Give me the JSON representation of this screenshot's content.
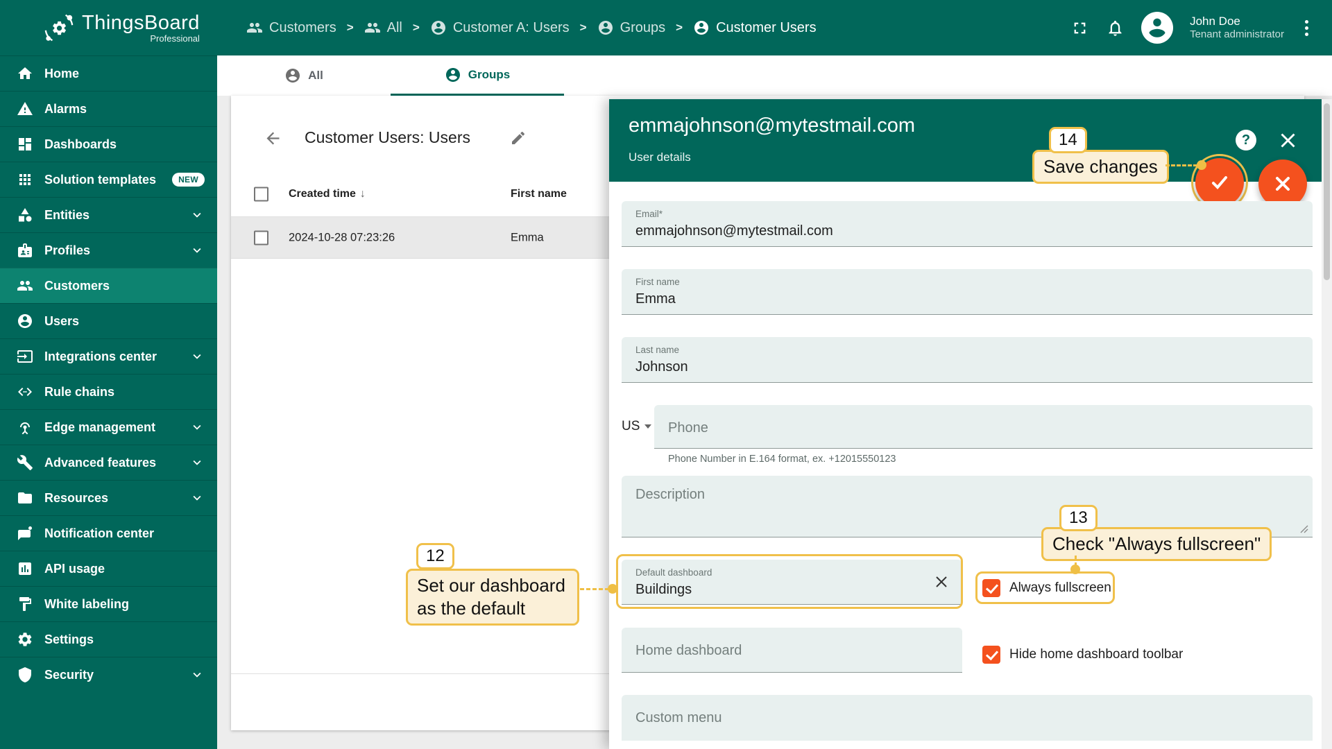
{
  "app": {
    "title": "ThingsBoard",
    "subtitle": "Professional"
  },
  "sidebar": {
    "items": [
      {
        "label": "Home",
        "icon": "home-icon"
      },
      {
        "label": "Alarms",
        "icon": "warning-icon"
      },
      {
        "label": "Dashboards",
        "icon": "dashboards-icon"
      },
      {
        "label": "Solution templates",
        "icon": "apps-icon",
        "badge": "NEW"
      },
      {
        "label": "Entities",
        "icon": "category-icon",
        "chevron": true
      },
      {
        "label": "Profiles",
        "icon": "badge-icon",
        "chevron": true
      },
      {
        "label": "Customers",
        "icon": "people-icon",
        "active": true
      },
      {
        "label": "Users",
        "icon": "account-icon"
      },
      {
        "label": "Integrations center",
        "icon": "integration-icon",
        "chevron": true
      },
      {
        "label": "Rule chains",
        "icon": "code-icon"
      },
      {
        "label": "Edge management",
        "icon": "antenna-icon",
        "chevron": true
      },
      {
        "label": "Advanced features",
        "icon": "tools-icon",
        "chevron": true
      },
      {
        "label": "Resources",
        "icon": "folder-icon",
        "chevron": true
      },
      {
        "label": "Notification center",
        "icon": "notification-icon"
      },
      {
        "label": "API usage",
        "icon": "chart-box-icon"
      },
      {
        "label": "White labeling",
        "icon": "paint-icon"
      },
      {
        "label": "Settings",
        "icon": "gear-icon"
      },
      {
        "label": "Security",
        "icon": "shield-icon",
        "chevron": true
      }
    ]
  },
  "header": {
    "breadcrumb": [
      {
        "label": "Customers",
        "icon": "people-icon"
      },
      {
        "label": "All",
        "icon": "people-icon"
      },
      {
        "label": "Customer A: Users",
        "icon": "account-icon"
      },
      {
        "label": "Groups",
        "icon": "account-icon"
      },
      {
        "label": "Customer Users",
        "icon": "account-icon"
      }
    ],
    "user": {
      "name": "John Doe",
      "role": "Tenant administrator"
    }
  },
  "tabs": [
    {
      "label": "All",
      "active": false
    },
    {
      "label": "Groups",
      "active": true
    }
  ],
  "table": {
    "title": "Customer Users: Users",
    "columns": [
      "Created time",
      "First name"
    ],
    "sort_arrow": "↓",
    "rows": [
      {
        "created_time": "2024-10-28 07:23:26",
        "first_name": "Emma"
      }
    ]
  },
  "panel": {
    "title": "emmajohnson@mytestmail.com",
    "subtitle": "User details",
    "help_glyph": "?",
    "fields": {
      "email": {
        "label": "Email*",
        "value": "emmajohnson@mytestmail.com"
      },
      "first_name": {
        "label": "First name",
        "value": "Emma"
      },
      "last_name": {
        "label": "Last name",
        "value": "Johnson"
      },
      "phone": {
        "country": "US",
        "placeholder": "Phone",
        "hint": "Phone Number in E.164 format, ex. +12015550123"
      },
      "description": {
        "placeholder": "Description"
      },
      "default_dashboard": {
        "label": "Default dashboard",
        "value": "Buildings"
      },
      "home_dashboard": {
        "placeholder": "Home dashboard"
      },
      "custom_menu": {
        "placeholder": "Custom menu"
      }
    },
    "checkboxes": {
      "always_fullscreen": {
        "label": "Always fullscreen",
        "checked": true
      },
      "hide_home_dashboard_toolbar": {
        "label": "Hide home dashboard toolbar",
        "checked": true
      }
    }
  },
  "annotations": {
    "step12": {
      "number": "12",
      "text": "Set our dashboard as the default"
    },
    "step13": {
      "number": "13",
      "text": "Check \"Always fullscreen\""
    },
    "step14": {
      "number": "14",
      "text": "Save changes"
    }
  },
  "colors": {
    "teal": "#01675A",
    "teal_active": "#0D8370",
    "orange": "#F4511E",
    "annotation_yellow": "#F0C04A",
    "callout_bg": "#FBF0D8",
    "field_bg": "#E8F0EF"
  }
}
